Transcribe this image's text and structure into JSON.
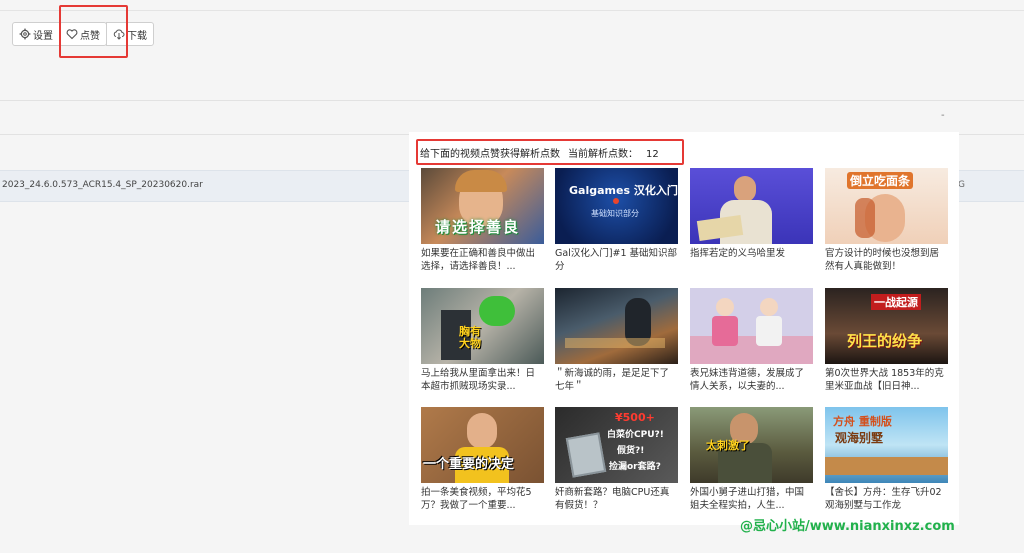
{
  "toolbar": {
    "settings_label": "设置",
    "like_label": "点赞",
    "download_label": "下载"
  },
  "file": {
    "name": "2023_24.6.0.573_ACR15.4_SP_20230620.rar",
    "tail": "G"
  },
  "misc": {
    "dash": "-"
  },
  "popup": {
    "instruction": "给下面的视频点赞获得解析点数",
    "points_label": "当前解析点数：",
    "points_value": "12",
    "videos": [
      {
        "caption": "如果要在正确和善良中做出选择，请选择善良！...",
        "overlay": "请选择善良",
        "icon": "child-thumbnail"
      },
      {
        "caption": "Gal汉化入门]#1 基础知识部分",
        "overlay": "Galgames 汉化入门",
        "overlay2": "基础知识部分",
        "icon": "presentation-thumbnail"
      },
      {
        "caption": "指挥若定的义乌哈里发",
        "overlay": "",
        "icon": "man-thumbnail"
      },
      {
        "caption": "官方设计的时候也没想到居然有人真能做到！",
        "overlay": "倒立吃面条",
        "icon": "anime-thumbnail"
      },
      {
        "caption": "马上给我从里面拿出来！日本超市抓贼现场实录...",
        "overlay": "胸有大物",
        "icon": "supermarket-thumbnail"
      },
      {
        "caption": "＂新海诚的雨，是足足下了七年＂",
        "overlay": "",
        "icon": "rain-thumbnail"
      },
      {
        "caption": "表兄妹违背道德，发展成了情人关系，以夫妻的...",
        "overlay": "",
        "icon": "cartoon-thumbnail"
      },
      {
        "caption": "第0次世界大战 1853年的克里米亚血战【旧日神...",
        "overlay": "一战起源",
        "overlay2": "列王的纷争",
        "icon": "history-thumbnail"
      },
      {
        "caption": "拍一条美食视频，平均花5万？我做了一个重要...",
        "overlay": "一个重要的决定",
        "icon": "vlogger-thumbnail"
      },
      {
        "caption": "奸商新套路？电脑CPU还真有假货！？",
        "overlay": "¥500+",
        "overlay2": "白菜价CPU?!",
        "overlay3": "假货?!",
        "overlay4": "捡漏or套路?",
        "icon": "cpu-thumbnail"
      },
      {
        "caption": "外国小舅子进山打猎，中国姐夫全程实拍，人生...",
        "overlay": "太刺激了",
        "icon": "hunting-thumbnail"
      },
      {
        "caption": "【舍长】方舟：生存飞升02 观海别墅与工作龙",
        "overlay": "方舟 重制版",
        "overlay2": "观海别墅",
        "icon": "game-thumbnail"
      }
    ]
  },
  "watermark": "@忌心小站/www.nianxinxz.com",
  "colors": {
    "highlight": "#e53935",
    "watermark": "#22b14c"
  }
}
